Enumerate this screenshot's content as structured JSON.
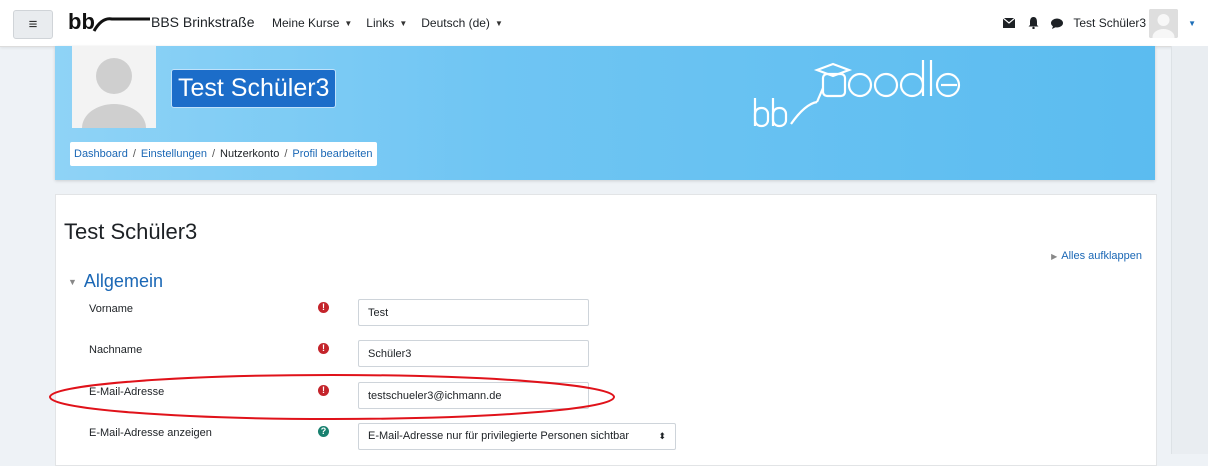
{
  "navbar": {
    "site_name": "BBS Brinkstraße",
    "menu": [
      {
        "label": "Meine Kurse"
      },
      {
        "label": "Links"
      },
      {
        "label": "Deutsch (de)"
      }
    ],
    "user_name": "Test Schüler3",
    "icons": [
      "menu-icon",
      "envelope-icon",
      "bell-icon",
      "chat-icon",
      "chevron-down-icon"
    ]
  },
  "hero": {
    "name": "Test Schüler3",
    "breadcrumb": [
      "Dashboard",
      "Einstellungen",
      "Nutzerkonto",
      "Profil bearbeiten"
    ],
    "logo_text": "bbmoodle"
  },
  "content": {
    "title": "Test Schüler3",
    "expand_all": "Alles aufklappen",
    "section_title": "Allgemein",
    "fields": [
      {
        "label": "Vorname",
        "value": "Test",
        "indicator": "required"
      },
      {
        "label": "Nachname",
        "value": "Schüler3",
        "indicator": "required"
      },
      {
        "label": "E-Mail-Adresse",
        "value": "testschueler3@ichmann.de",
        "indicator": "required"
      },
      {
        "label": "E-Mail-Adresse anzeigen",
        "value": "E-Mail-Adresse nur für privilegierte Personen sichtbar",
        "indicator": "help"
      }
    ]
  },
  "colors": {
    "accent": "#1a67b5",
    "hero_blue": "#6fc5f3",
    "name_badge": "#1c6dc9",
    "required": "#c4242b",
    "help": "#18816f",
    "highlight_ellipse": "#e0121a"
  }
}
